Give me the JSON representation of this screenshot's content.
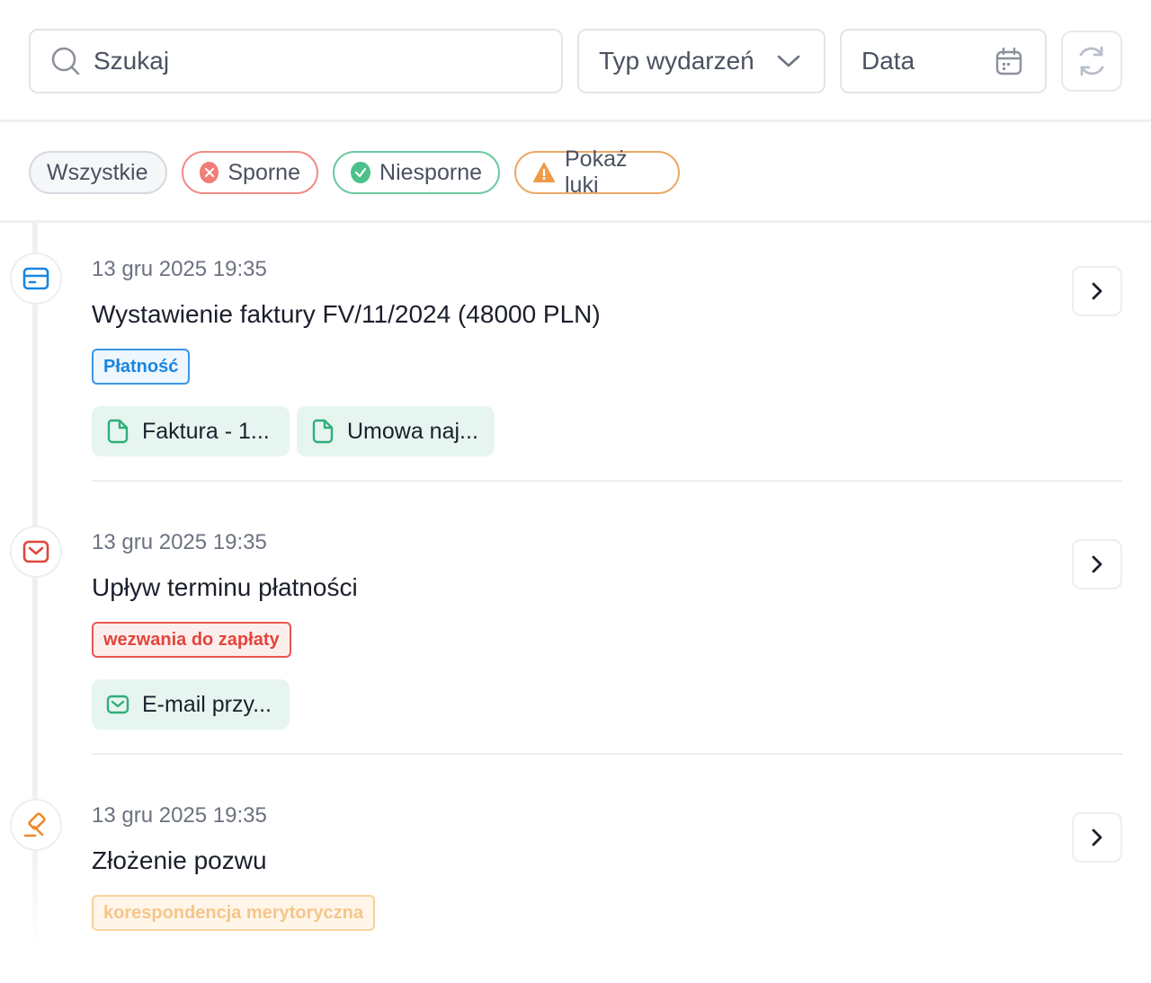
{
  "toolbar": {
    "search_placeholder": "Szukaj",
    "event_type_label": "Typ wydarzeń",
    "date_label": "Data"
  },
  "filters": {
    "all": "Wszystkie",
    "disputed": "Sporne",
    "undisputed": "Niesporne",
    "gaps": "Pokaż luki"
  },
  "colors": {
    "disputed": "#ef7f78",
    "undisputed": "#4cc28a",
    "gaps": "#ee9b4a",
    "payment": "#1a86e0",
    "demand": "#e2453a",
    "correspondence": "#f5c58a",
    "attachment_bg": "#e7f5f0"
  },
  "events": [
    {
      "date": "13 gru 2025  19:35",
      "title": "Wystawienie faktury FV/11/2024 (48000 PLN)",
      "tag": "Płatność",
      "icon": "credit-card-icon",
      "attachments": [
        {
          "label": "Faktura - 1...",
          "icon": "document-icon"
        },
        {
          "label": "Umowa naj...",
          "icon": "document-icon"
        }
      ]
    },
    {
      "date": "13 gru 2025  19:35",
      "title": "Upływ terminu płatności",
      "tag": "wezwania do zapłaty",
      "icon": "mail-icon",
      "attachments": [
        {
          "label": "E-mail przy...",
          "icon": "mail-icon"
        }
      ]
    },
    {
      "date": "13 gru 2025  19:35",
      "title": "Złożenie pozwu",
      "tag": "korespondencja merytoryczna",
      "icon": "gavel-icon",
      "attachments": []
    }
  ]
}
